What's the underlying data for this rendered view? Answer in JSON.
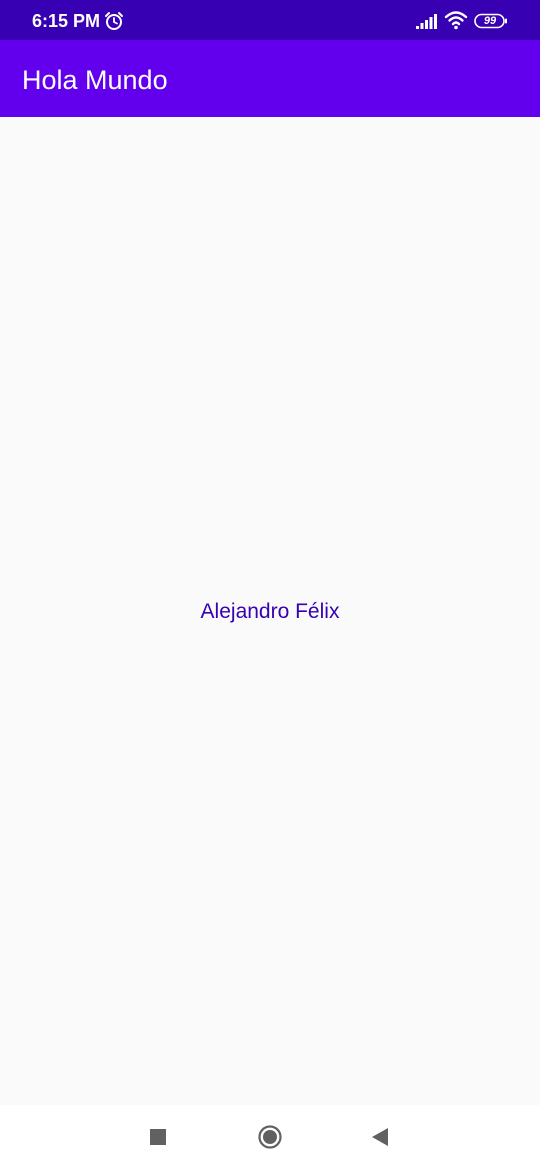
{
  "status_bar": {
    "time": "6:15 PM",
    "battery_level": "99",
    "icons": [
      "alarm-icon",
      "signal-icon",
      "wifi-icon",
      "battery-icon"
    ]
  },
  "app_bar": {
    "title": "Hola Mundo",
    "background_color": "#6200ee"
  },
  "main": {
    "text": "Alejandro Félix",
    "text_color": "#3700b3"
  },
  "navigation_bar": {
    "buttons": [
      "recents-icon",
      "home-icon",
      "back-icon"
    ]
  },
  "colors": {
    "status_bar": "#3700b3",
    "background": "#fafafa"
  }
}
